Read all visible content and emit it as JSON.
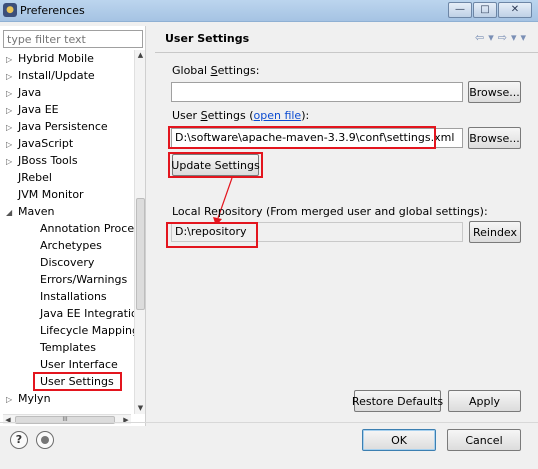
{
  "window": {
    "title": "Preferences",
    "minimize": "—",
    "maximize": "□",
    "close": "✕"
  },
  "filter": {
    "placeholder": "type filter text"
  },
  "tree": {
    "items": [
      {
        "label": "Hybrid Mobile",
        "expander": "▷"
      },
      {
        "label": "Install/Update",
        "expander": "▷"
      },
      {
        "label": "Java",
        "expander": "▷"
      },
      {
        "label": "Java EE",
        "expander": "▷"
      },
      {
        "label": "Java Persistence",
        "expander": "▷"
      },
      {
        "label": "JavaScript",
        "expander": "▷"
      },
      {
        "label": "JBoss Tools",
        "expander": "▷"
      },
      {
        "label": "JRebel",
        "expander": ""
      },
      {
        "label": "JVM Monitor",
        "expander": ""
      },
      {
        "label": "Maven",
        "expander": "◢"
      },
      {
        "label": "Annotation Processing",
        "expander": ""
      },
      {
        "label": "Archetypes",
        "expander": ""
      },
      {
        "label": "Discovery",
        "expander": ""
      },
      {
        "label": "Errors/Warnings",
        "expander": ""
      },
      {
        "label": "Installations",
        "expander": ""
      },
      {
        "label": "Java EE Integration",
        "expander": ""
      },
      {
        "label": "Lifecycle Mappings",
        "expander": ""
      },
      {
        "label": "Templates",
        "expander": ""
      },
      {
        "label": "User Interface",
        "expander": ""
      },
      {
        "label": "User Settings",
        "expander": ""
      },
      {
        "label": "Mylyn",
        "expander": "▷"
      }
    ],
    "hscroll_thumb": "III"
  },
  "page": {
    "title": "User Settings",
    "nav_back": "⇦",
    "nav_back_menu": "▾",
    "nav_forward": "⇨",
    "nav_forward_menu": "▾",
    "view_menu": "▾"
  },
  "global": {
    "label_prefix": "Global ",
    "label_key": "S",
    "label_suffix": "ettings:",
    "value": "",
    "browse": "Browse..."
  },
  "user": {
    "label_prefix": "User ",
    "label_key": "S",
    "label_suffix": "ettings (",
    "link": "open file",
    "label_end": "):",
    "value": "D:\\software\\apache-maven-3.3.9\\conf\\settings.xml",
    "browse": "Browse...",
    "update": "Update Settings"
  },
  "local": {
    "label": "Local Repository (From merged user and global settings):",
    "value": "D:\\repository",
    "reindex": "Reindex"
  },
  "buttons": {
    "restore": "Restore Defaults",
    "apply": "Apply",
    "ok": "OK",
    "cancel": "Cancel"
  },
  "footer": {
    "help_glyph": "?"
  },
  "colors": {
    "highlight_box": "#e3151e",
    "link": "#0b4bd1",
    "title_bar": "#bcd5ee"
  }
}
